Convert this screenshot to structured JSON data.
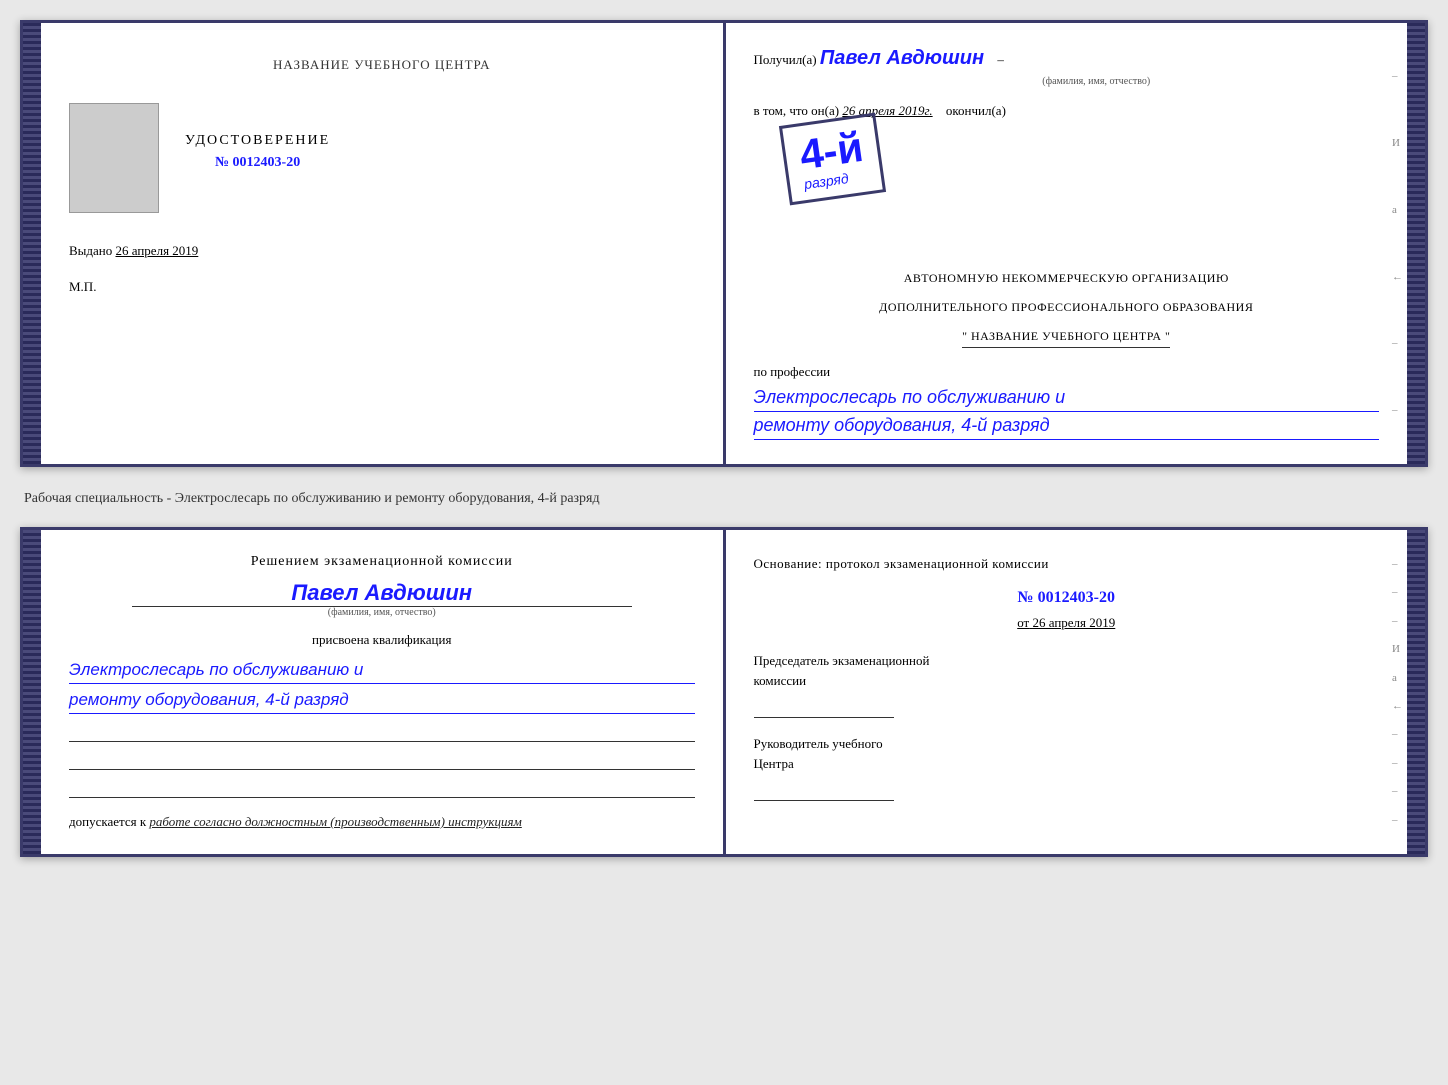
{
  "doc": {
    "top_left": {
      "title": "НАЗВАНИЕ УЧЕБНОГО ЦЕНТРА",
      "type": "УДОСТОВЕРЕНИЕ",
      "number_prefix": "№",
      "number": "0012403-20",
      "vydano_label": "Выдано",
      "vydano_date": "26 апреля 2019",
      "mp": "М.П."
    },
    "top_right": {
      "received_label": "Получил(a)",
      "received_name": "Павел Авдюшин",
      "fio_sub": "(фамилия, имя, отчество)",
      "vtom_label": "в том, что он(а)",
      "vtom_date": "26 апреля 2019г.",
      "okonchil_label": "окончил(а)",
      "grade": "4-й",
      "grade_sub": "разряд",
      "org_line1": "АВТОНОМНУЮ НЕКОММЕРЧЕСКУЮ ОРГАНИЗАЦИЮ",
      "org_line2": "ДОПОЛНИТЕЛЬНОГО ПРОФЕССИОНАЛЬНОГО ОБРАЗОВАНИЯ",
      "org_name": "\" НАЗВАНИЕ УЧЕБНОГО ЦЕНТРА \"",
      "po_professii": "по профессии",
      "profession_line1": "Электрослесарь по обслуживанию и",
      "profession_line2": "ремонту оборудования, 4-й разряд"
    },
    "middle_text": "Рабочая специальность - Электрослесарь по обслуживанию и ремонту оборудования, 4-й разряд",
    "bottom_left": {
      "resheniem": "Решением экзаменационной комиссии",
      "person_name": "Павел Авдюшин",
      "fio_sub": "(фамилия, имя, отчество)",
      "prisvoena": "присвоена квалификация",
      "qualification_line1": "Электрослесарь по обслуживанию и",
      "qualification_line2": "ремонту оборудования, 4-й разряд",
      "dopuskaetsya": "допускается к",
      "dopuskaetsya_italic": "работе согласно должностным (производственным) инструкциям"
    },
    "bottom_right": {
      "osnovanie": "Основание: протокол экзаменационной комиссии",
      "number_prefix": "№",
      "number": "0012403-20",
      "ot_prefix": "от",
      "ot_date": "26 апреля 2019",
      "predsedatel_line1": "Председатель экзаменационной",
      "predsedatel_line2": "комиссии",
      "rukovoditel_line1": "Руководитель учебного",
      "rukovoditel_line2": "Центра"
    },
    "right_marks": [
      "-",
      "И",
      "а",
      "←",
      "-",
      "-",
      "-",
      "-"
    ]
  }
}
